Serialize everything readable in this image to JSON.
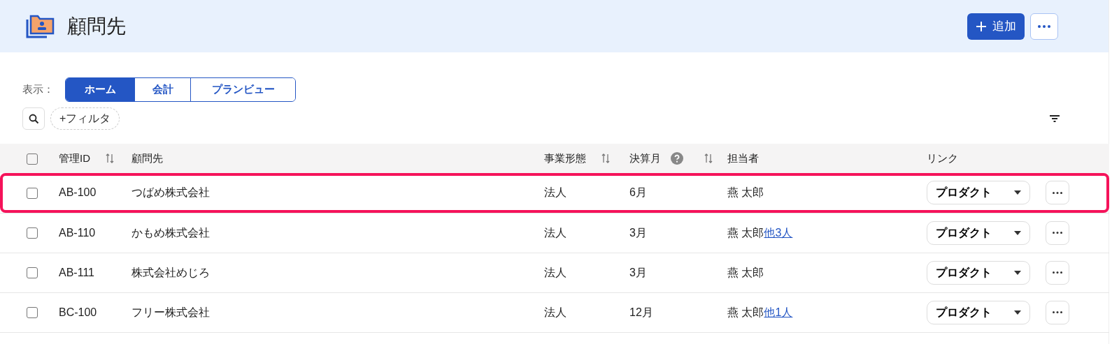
{
  "header": {
    "title": "顧問先",
    "add_button": "追加"
  },
  "view": {
    "label": "表示：",
    "tabs": [
      {
        "label": "ホーム",
        "selected": true
      },
      {
        "label": "会計",
        "selected": false
      },
      {
        "label": "プランビュー",
        "selected": false
      }
    ]
  },
  "filter_button": "+フィルタ",
  "table": {
    "columns": [
      {
        "label": "管理ID",
        "sortable": true,
        "help": false
      },
      {
        "label": "顧問先",
        "sortable": false,
        "help": false
      },
      {
        "label": "事業形態",
        "sortable": true,
        "help": false
      },
      {
        "label": "決算月",
        "sortable": true,
        "help": true
      },
      {
        "label": "担当者",
        "sortable": false,
        "help": false
      },
      {
        "label": "リンク",
        "sortable": false,
        "help": false
      }
    ],
    "all_checked": false,
    "rows": [
      {
        "id": "AB-100",
        "client": "つばめ株式会社",
        "type": "法人",
        "month": "6月",
        "staff": "燕 太郎",
        "others": null,
        "link": "プロダクト",
        "checked": false,
        "highlighted": true
      },
      {
        "id": "AB-110",
        "client": "かもめ株式会社",
        "type": "法人",
        "month": "3月",
        "staff": "燕 太郎",
        "others": "他3人",
        "link": "プロダクト",
        "checked": false,
        "highlighted": false
      },
      {
        "id": "AB-111",
        "client": "株式会社めじろ",
        "type": "法人",
        "month": "3月",
        "staff": "燕 太郎",
        "others": null,
        "link": "プロダクト",
        "checked": false,
        "highlighted": false
      },
      {
        "id": "BC-100",
        "client": "フリー株式会社",
        "type": "法人",
        "month": "12月",
        "staff": "燕 太郎",
        "others": "他1人",
        "link": "プロダクト",
        "checked": false,
        "highlighted": false
      }
    ]
  }
}
